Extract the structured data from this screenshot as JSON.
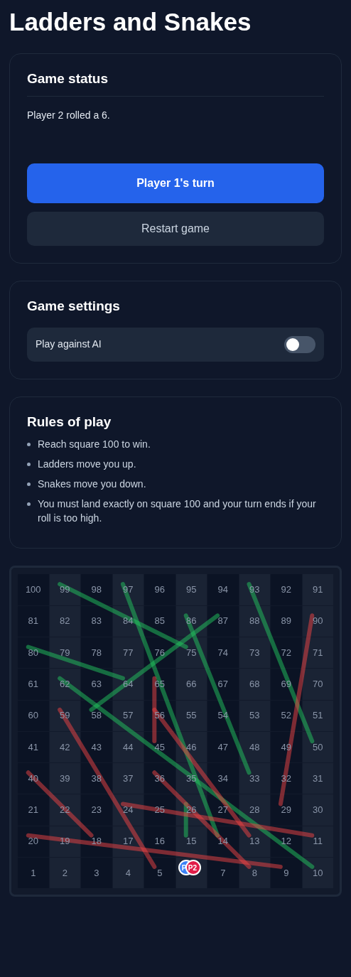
{
  "title": "Ladders and Snakes",
  "status": {
    "heading": "Game status",
    "message": "Player 2 rolled a 6.",
    "buttons": [
      {
        "label": "Player 1's turn",
        "kind": "primary"
      },
      {
        "label": "Restart game",
        "kind": "secondary"
      }
    ]
  },
  "settings": {
    "heading": "Game settings",
    "toggles": [
      {
        "label": "Play against AI",
        "on": false
      }
    ]
  },
  "rules": {
    "heading": "Rules of play",
    "items": [
      "Reach square 100 to win.",
      "Ladders move you up.",
      "Snakes move you down.",
      "You must land exactly on square 100 and your turn ends if your roll is too high."
    ]
  },
  "board": {
    "rows": [
      [
        "100",
        "99",
        "98",
        "97",
        "96",
        "95",
        "94",
        "93",
        "92",
        "91"
      ],
      [
        "81",
        "82",
        "83",
        "84",
        "85",
        "86",
        "87",
        "88",
        "89",
        "90"
      ],
      [
        "80",
        "79",
        "78",
        "77",
        "76",
        "75",
        "74",
        "73",
        "72",
        "71"
      ],
      [
        "61",
        "62",
        "63",
        "64",
        "65",
        "66",
        "67",
        "68",
        "69",
        "70"
      ],
      [
        "60",
        "59",
        "58",
        "57",
        "56",
        "55",
        "54",
        "53",
        "52",
        "51"
      ],
      [
        "41",
        "42",
        "43",
        "44",
        "45",
        "46",
        "47",
        "48",
        "49",
        "50"
      ],
      [
        "40",
        "39",
        "38",
        "37",
        "36",
        "35",
        "34",
        "33",
        "32",
        "31"
      ],
      [
        "21",
        "22",
        "23",
        "24",
        "25",
        "26",
        "27",
        "28",
        "29",
        "30"
      ],
      [
        "20",
        "19",
        "18",
        "17",
        "16",
        "15",
        "14",
        "13",
        "12",
        "11"
      ],
      [
        "1",
        "2",
        "3",
        "4",
        "5",
        null,
        "7",
        "8",
        "9",
        "10"
      ]
    ],
    "links": [
      {
        "kind": "ladder"
      },
      {
        "kind": "ladder"
      },
      {
        "kind": "ladder"
      },
      {
        "kind": "ladder"
      },
      {
        "kind": "ladder"
      },
      {
        "kind": "ladder"
      },
      {
        "kind": "ladder"
      },
      {
        "kind": "ladder"
      },
      {
        "kind": "snake"
      },
      {
        "kind": "snake"
      },
      {
        "kind": "snake"
      },
      {
        "kind": "snake"
      },
      {
        "kind": "snake"
      },
      {
        "kind": "snake"
      },
      {
        "kind": "snake"
      },
      {
        "kind": "snake"
      }
    ],
    "tokens": [
      {
        "label": "P",
        "color": "#3b82f6"
      },
      {
        "label": "P2",
        "color": "#e11d48"
      }
    ]
  }
}
